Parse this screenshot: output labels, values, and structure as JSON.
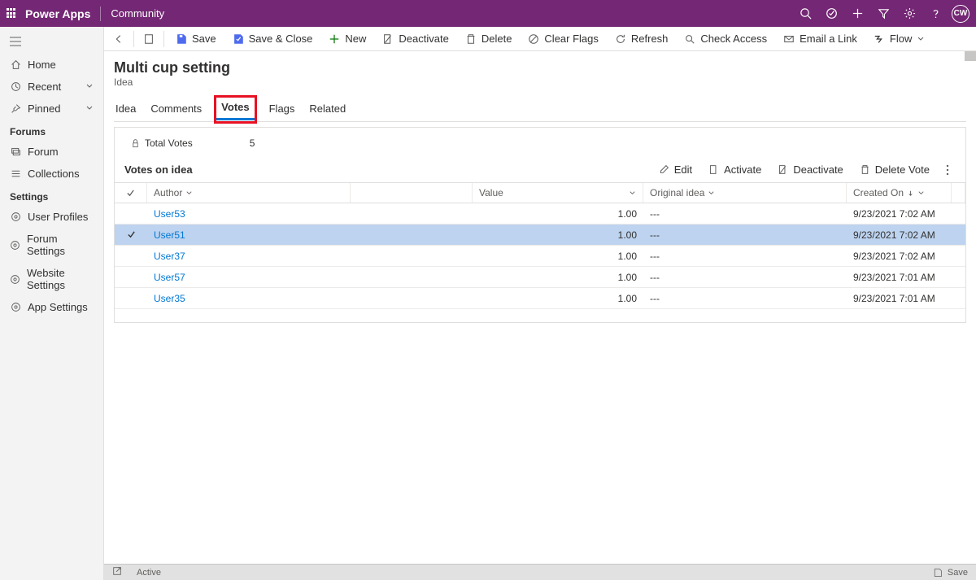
{
  "topbar": {
    "brand": "Power Apps",
    "sub_brand": "Community",
    "avatar_initials": "CW"
  },
  "left_nav": {
    "home": "Home",
    "recent": "Recent",
    "pinned": "Pinned",
    "section_forums": "Forums",
    "forum": "Forum",
    "collections": "Collections",
    "section_settings": "Settings",
    "user_profiles": "User Profiles",
    "forum_settings": "Forum Settings",
    "website_settings": "Website Settings",
    "app_settings": "App Settings"
  },
  "cmdbar": {
    "save": "Save",
    "save_close": "Save & Close",
    "new": "New",
    "deactivate": "Deactivate",
    "delete": "Delete",
    "clear_flags": "Clear Flags",
    "refresh": "Refresh",
    "check_access": "Check Access",
    "email_link": "Email a Link",
    "flow": "Flow"
  },
  "record": {
    "title": "Multi cup setting",
    "subtitle": "Idea",
    "tabs": {
      "idea": "Idea",
      "comments": "Comments",
      "votes": "Votes",
      "flags": "Flags",
      "related": "Related"
    }
  },
  "votes_panel": {
    "total_label": "Total Votes",
    "total_value": "5",
    "section_title": "Votes on idea",
    "actions": {
      "edit": "Edit",
      "activate": "Activate",
      "deactivate": "Deactivate",
      "delete": "Delete Vote"
    },
    "columns": {
      "author": "Author",
      "value": "Value",
      "original": "Original idea",
      "created": "Created On"
    },
    "rows": [
      {
        "author": "User53",
        "value": "1.00",
        "original": "---",
        "created": "9/23/2021 7:02 AM",
        "selected": false
      },
      {
        "author": "User51",
        "value": "1.00",
        "original": "---",
        "created": "9/23/2021 7:02 AM",
        "selected": true
      },
      {
        "author": "User37",
        "value": "1.00",
        "original": "---",
        "created": "9/23/2021 7:02 AM",
        "selected": false
      },
      {
        "author": "User57",
        "value": "1.00",
        "original": "---",
        "created": "9/23/2021 7:01 AM",
        "selected": false
      },
      {
        "author": "User35",
        "value": "1.00",
        "original": "---",
        "created": "9/23/2021 7:01 AM",
        "selected": false
      }
    ]
  },
  "statusbar": {
    "status": "Active",
    "save": "Save"
  }
}
